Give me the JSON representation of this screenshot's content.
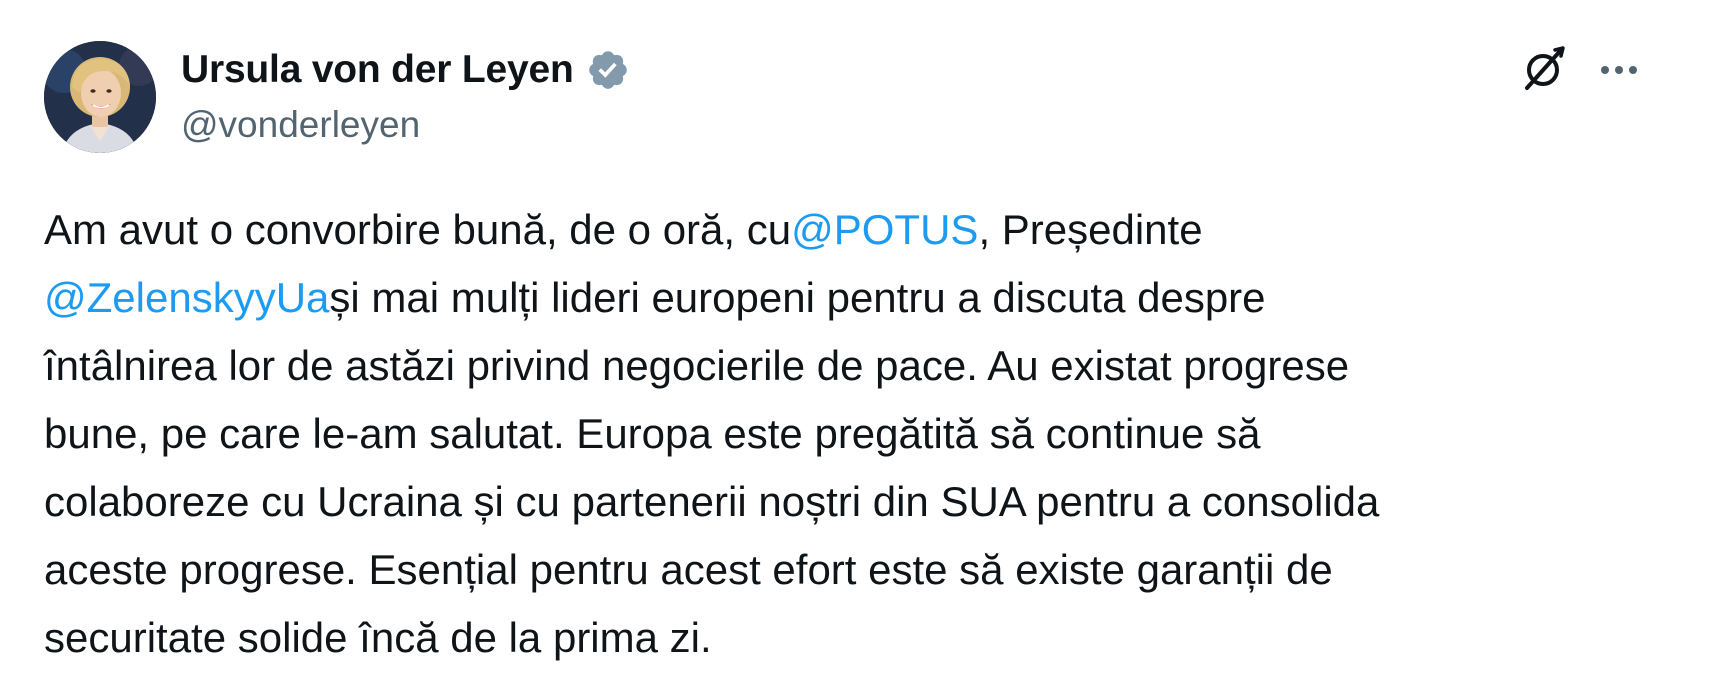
{
  "author": {
    "display_name": "Ursula von der Leyen",
    "handle": "@vonderleyen",
    "verified_color": "#829aab"
  },
  "actions": {
    "grok_icon": "grok-icon",
    "more_icon": "more-icon"
  },
  "tweet": {
    "line1_part1": "Am avut o convorbire bună, de o oră, cu",
    "mention_potus": "@POTUS",
    "line1_part2": ", Președinte",
    "mention_zelensky": "@ZelenskyyUa",
    "line2_part1": "și mai mulți lideri europeni pentru a discuta despre",
    "line3": "întâlnirea lor de astăzi privind negocierile de pace. Au existat progrese",
    "line4": "bune, pe care le-am salutat. Europa este pregătită să continue să",
    "line5": "colaboreze cu Ucraina și cu partenerii noștri din SUA pentru a consolida",
    "line6": "aceste progrese. Esențial pentru acest efort este să existe garanții de",
    "line7": "securitate solide încă de la prima zi."
  },
  "colors": {
    "text": "#0f1419",
    "secondary": "#536471",
    "link": "#1d9bf0"
  }
}
